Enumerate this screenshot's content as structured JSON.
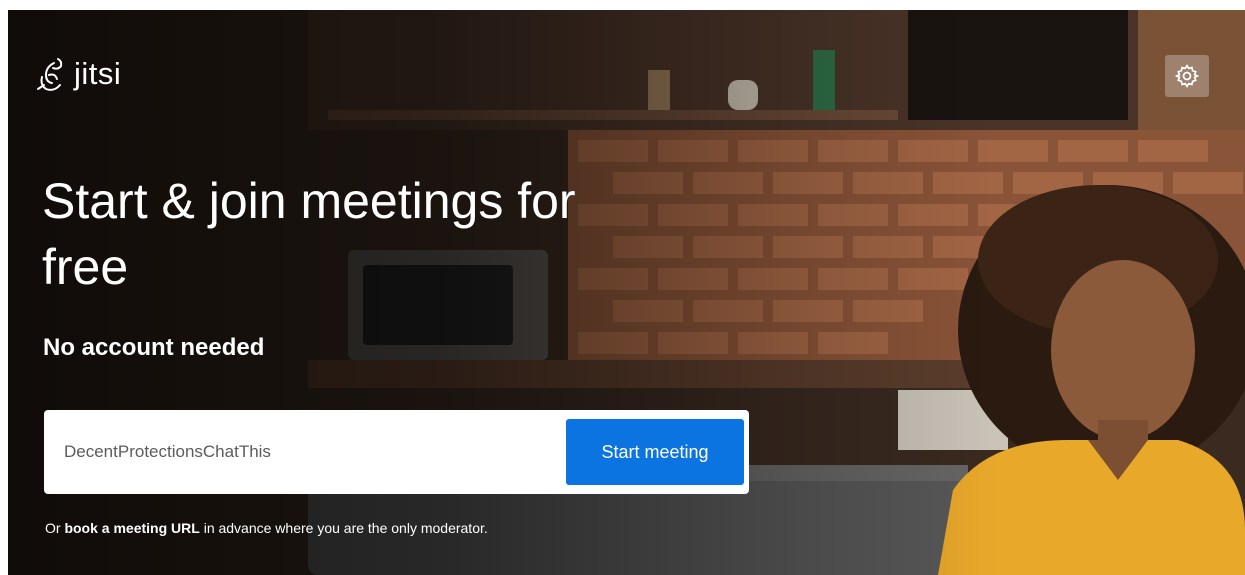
{
  "colors": {
    "accent": "#0b74e0",
    "overlay": "#000000",
    "text": "#ffffff",
    "shirt": "#e8a82a"
  },
  "logo": {
    "text": "jitsi",
    "icon": "jitsi-bird-icon"
  },
  "header": {
    "settings_icon": "gear-icon"
  },
  "hero": {
    "headline_line1": "Start & join meetings for",
    "headline_line2": "free",
    "subheading": "No account needed"
  },
  "meeting_form": {
    "room_name_value": "DecentProtectionsChatThis",
    "start_button_label": "Start meeting"
  },
  "footer_note": {
    "prefix": "Or ",
    "link_text": "book a meeting URL",
    "suffix": " in advance where you are the only moderator."
  }
}
